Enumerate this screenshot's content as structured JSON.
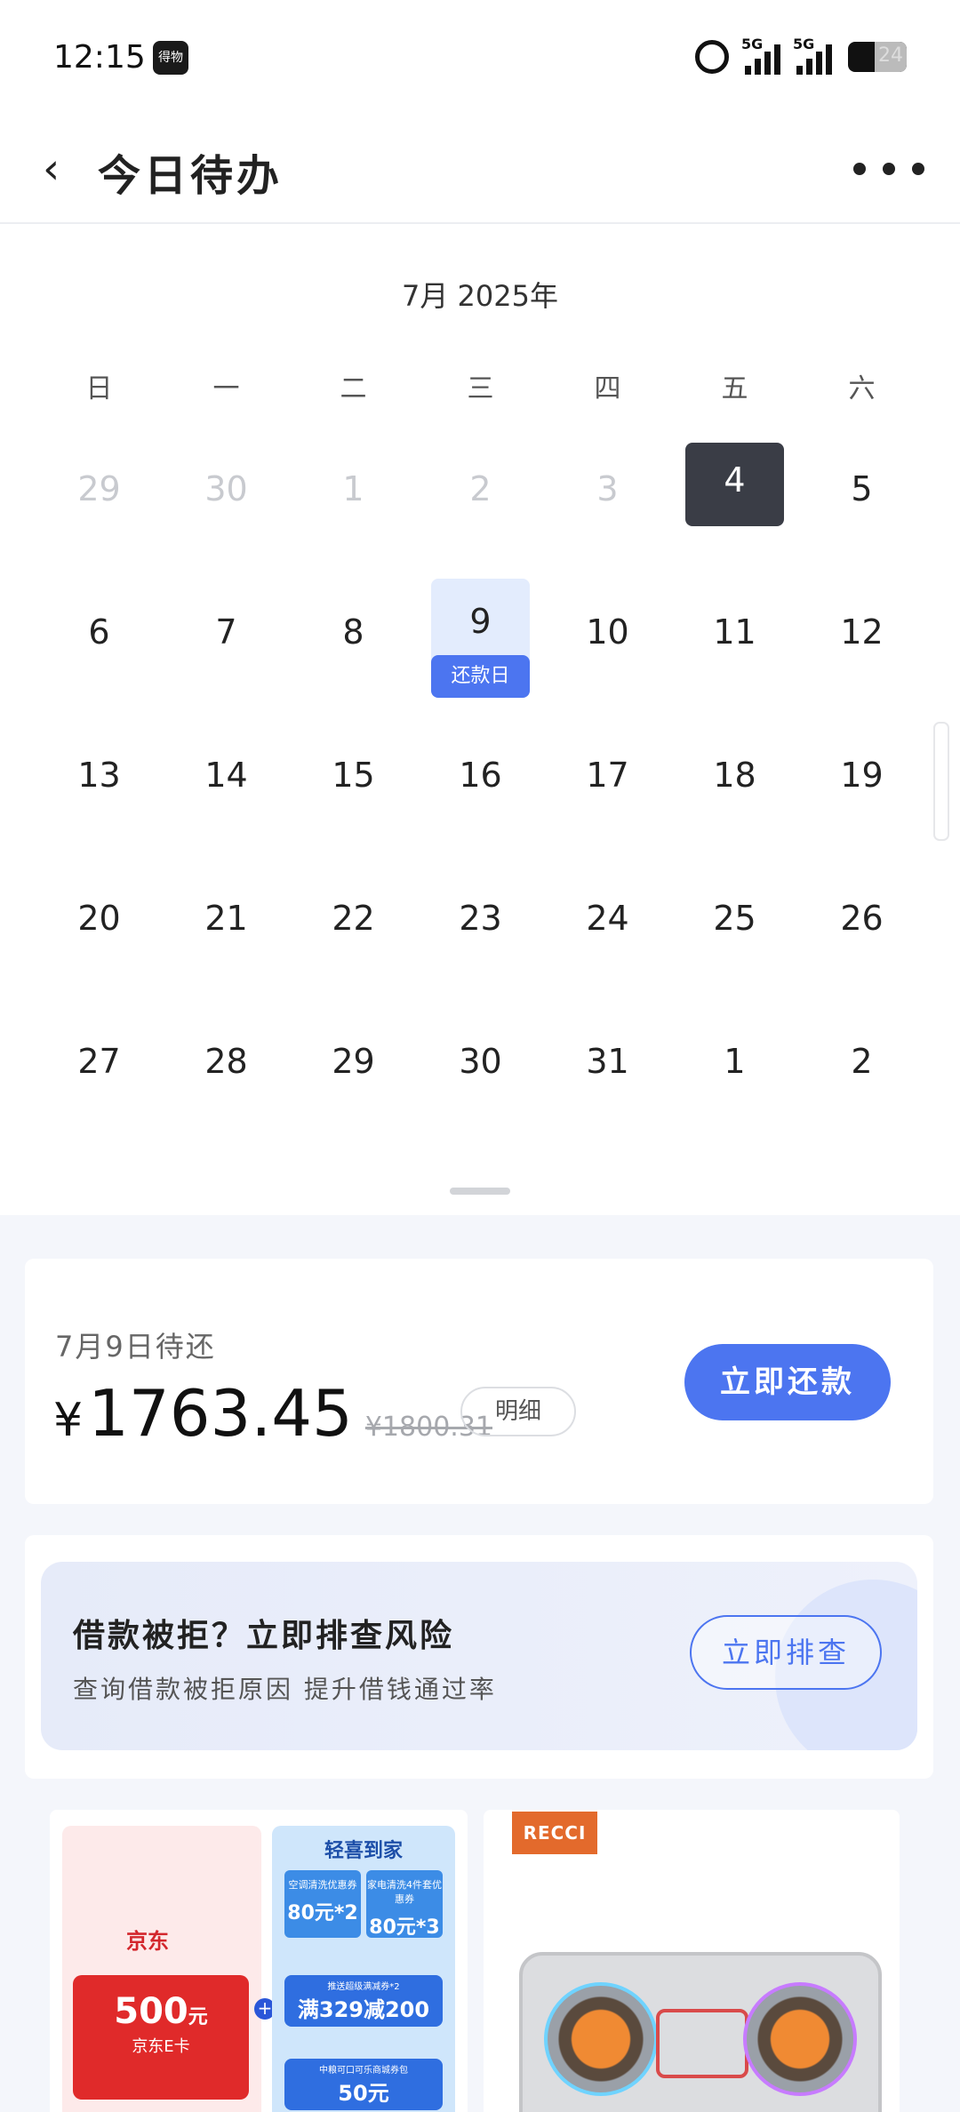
{
  "status_bar": {
    "time": "12:15",
    "app_icon_text": "得物",
    "signal1": "5G",
    "signal2": "5G",
    "battery": "24"
  },
  "nav": {
    "title": "今日待办"
  },
  "calendar": {
    "month_label": "7月 2025年",
    "weekdays": [
      "日",
      "一",
      "二",
      "三",
      "四",
      "五",
      "六"
    ],
    "weeks": [
      [
        "29",
        "30",
        "1",
        "2",
        "3",
        "4",
        "5"
      ],
      [
        "6",
        "7",
        "8",
        "9",
        "10",
        "11",
        "12"
      ],
      [
        "13",
        "14",
        "15",
        "16",
        "17",
        "18",
        "19"
      ],
      [
        "20",
        "21",
        "22",
        "23",
        "24",
        "25",
        "26"
      ],
      [
        "27",
        "28",
        "29",
        "30",
        "31",
        "1",
        "2"
      ]
    ],
    "today": "4",
    "repay_day": "9",
    "repay_day_label": "还款日"
  },
  "due": {
    "label": "7月9日待还",
    "currency": "¥",
    "amount": "1763.45",
    "original": "¥1800.31",
    "detail_label": "明细",
    "repay_button": "立即还款"
  },
  "risk": {
    "title": "借款被拒？立即排查风险",
    "subtitle": "查询借款被拒原因 提升借钱通过率",
    "button": "立即排查"
  },
  "products": {
    "left": {
      "jd_logo": "京东",
      "gift_amount": "500",
      "gift_unit": "元",
      "gift_name": "京东E卡",
      "qx_logo": "轻喜到家",
      "coupon1_title": "空调清洗优惠券",
      "coupon1_value": "80元*2",
      "coupon2_title": "家电清洗4件套优惠券",
      "coupon2_value": "80元*3",
      "coupon3_title": "推送超级满减券*2",
      "coupon3_value": "满329减200",
      "coupon4_title": "中粮可口可乐商城券包",
      "coupon4_value": "50元"
    },
    "right": {
      "brand": "RECCI"
    }
  },
  "colors": {
    "accent": "#4c75f0",
    "today_bg": "#3a3d46",
    "repay_bg": "#e3ecfd"
  }
}
